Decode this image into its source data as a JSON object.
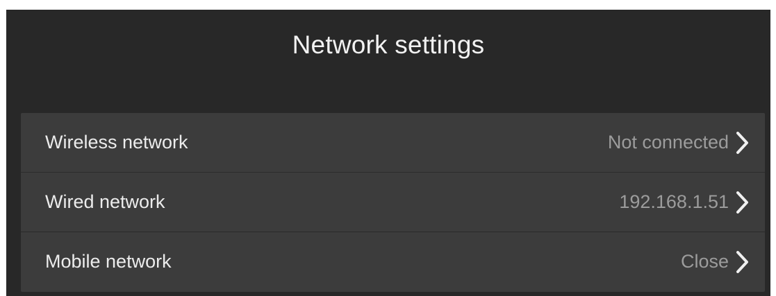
{
  "header": {
    "title": "Network settings"
  },
  "settings": {
    "items": [
      {
        "label": "Wireless network",
        "value": "Not connected",
        "icon": "chevron-right-icon"
      },
      {
        "label": "Wired network",
        "value": "192.168.1.51",
        "icon": "chevron-right-icon"
      },
      {
        "label": "Mobile network",
        "value": "Close",
        "icon": "chevron-right-icon"
      }
    ]
  },
  "colors": {
    "background": "#282828",
    "row_background": "#3c3c3c",
    "label_text": "#ececec",
    "value_text": "#9c9c9c",
    "chevron": "#f0f0f0"
  }
}
